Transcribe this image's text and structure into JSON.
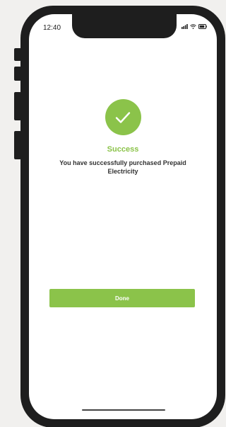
{
  "status_bar": {
    "time": "12:40",
    "icons": [
      "signal-icon",
      "wifi-icon",
      "battery-icon"
    ]
  },
  "success": {
    "icon": "checkmark-icon",
    "title": "Success",
    "message": "You have successfully purchased Prepaid Electricity"
  },
  "done_button": {
    "label": "Done"
  },
  "colors": {
    "accent": "#8bc34a",
    "frame": "#1e1e1e",
    "background": "#f1f0ee"
  }
}
